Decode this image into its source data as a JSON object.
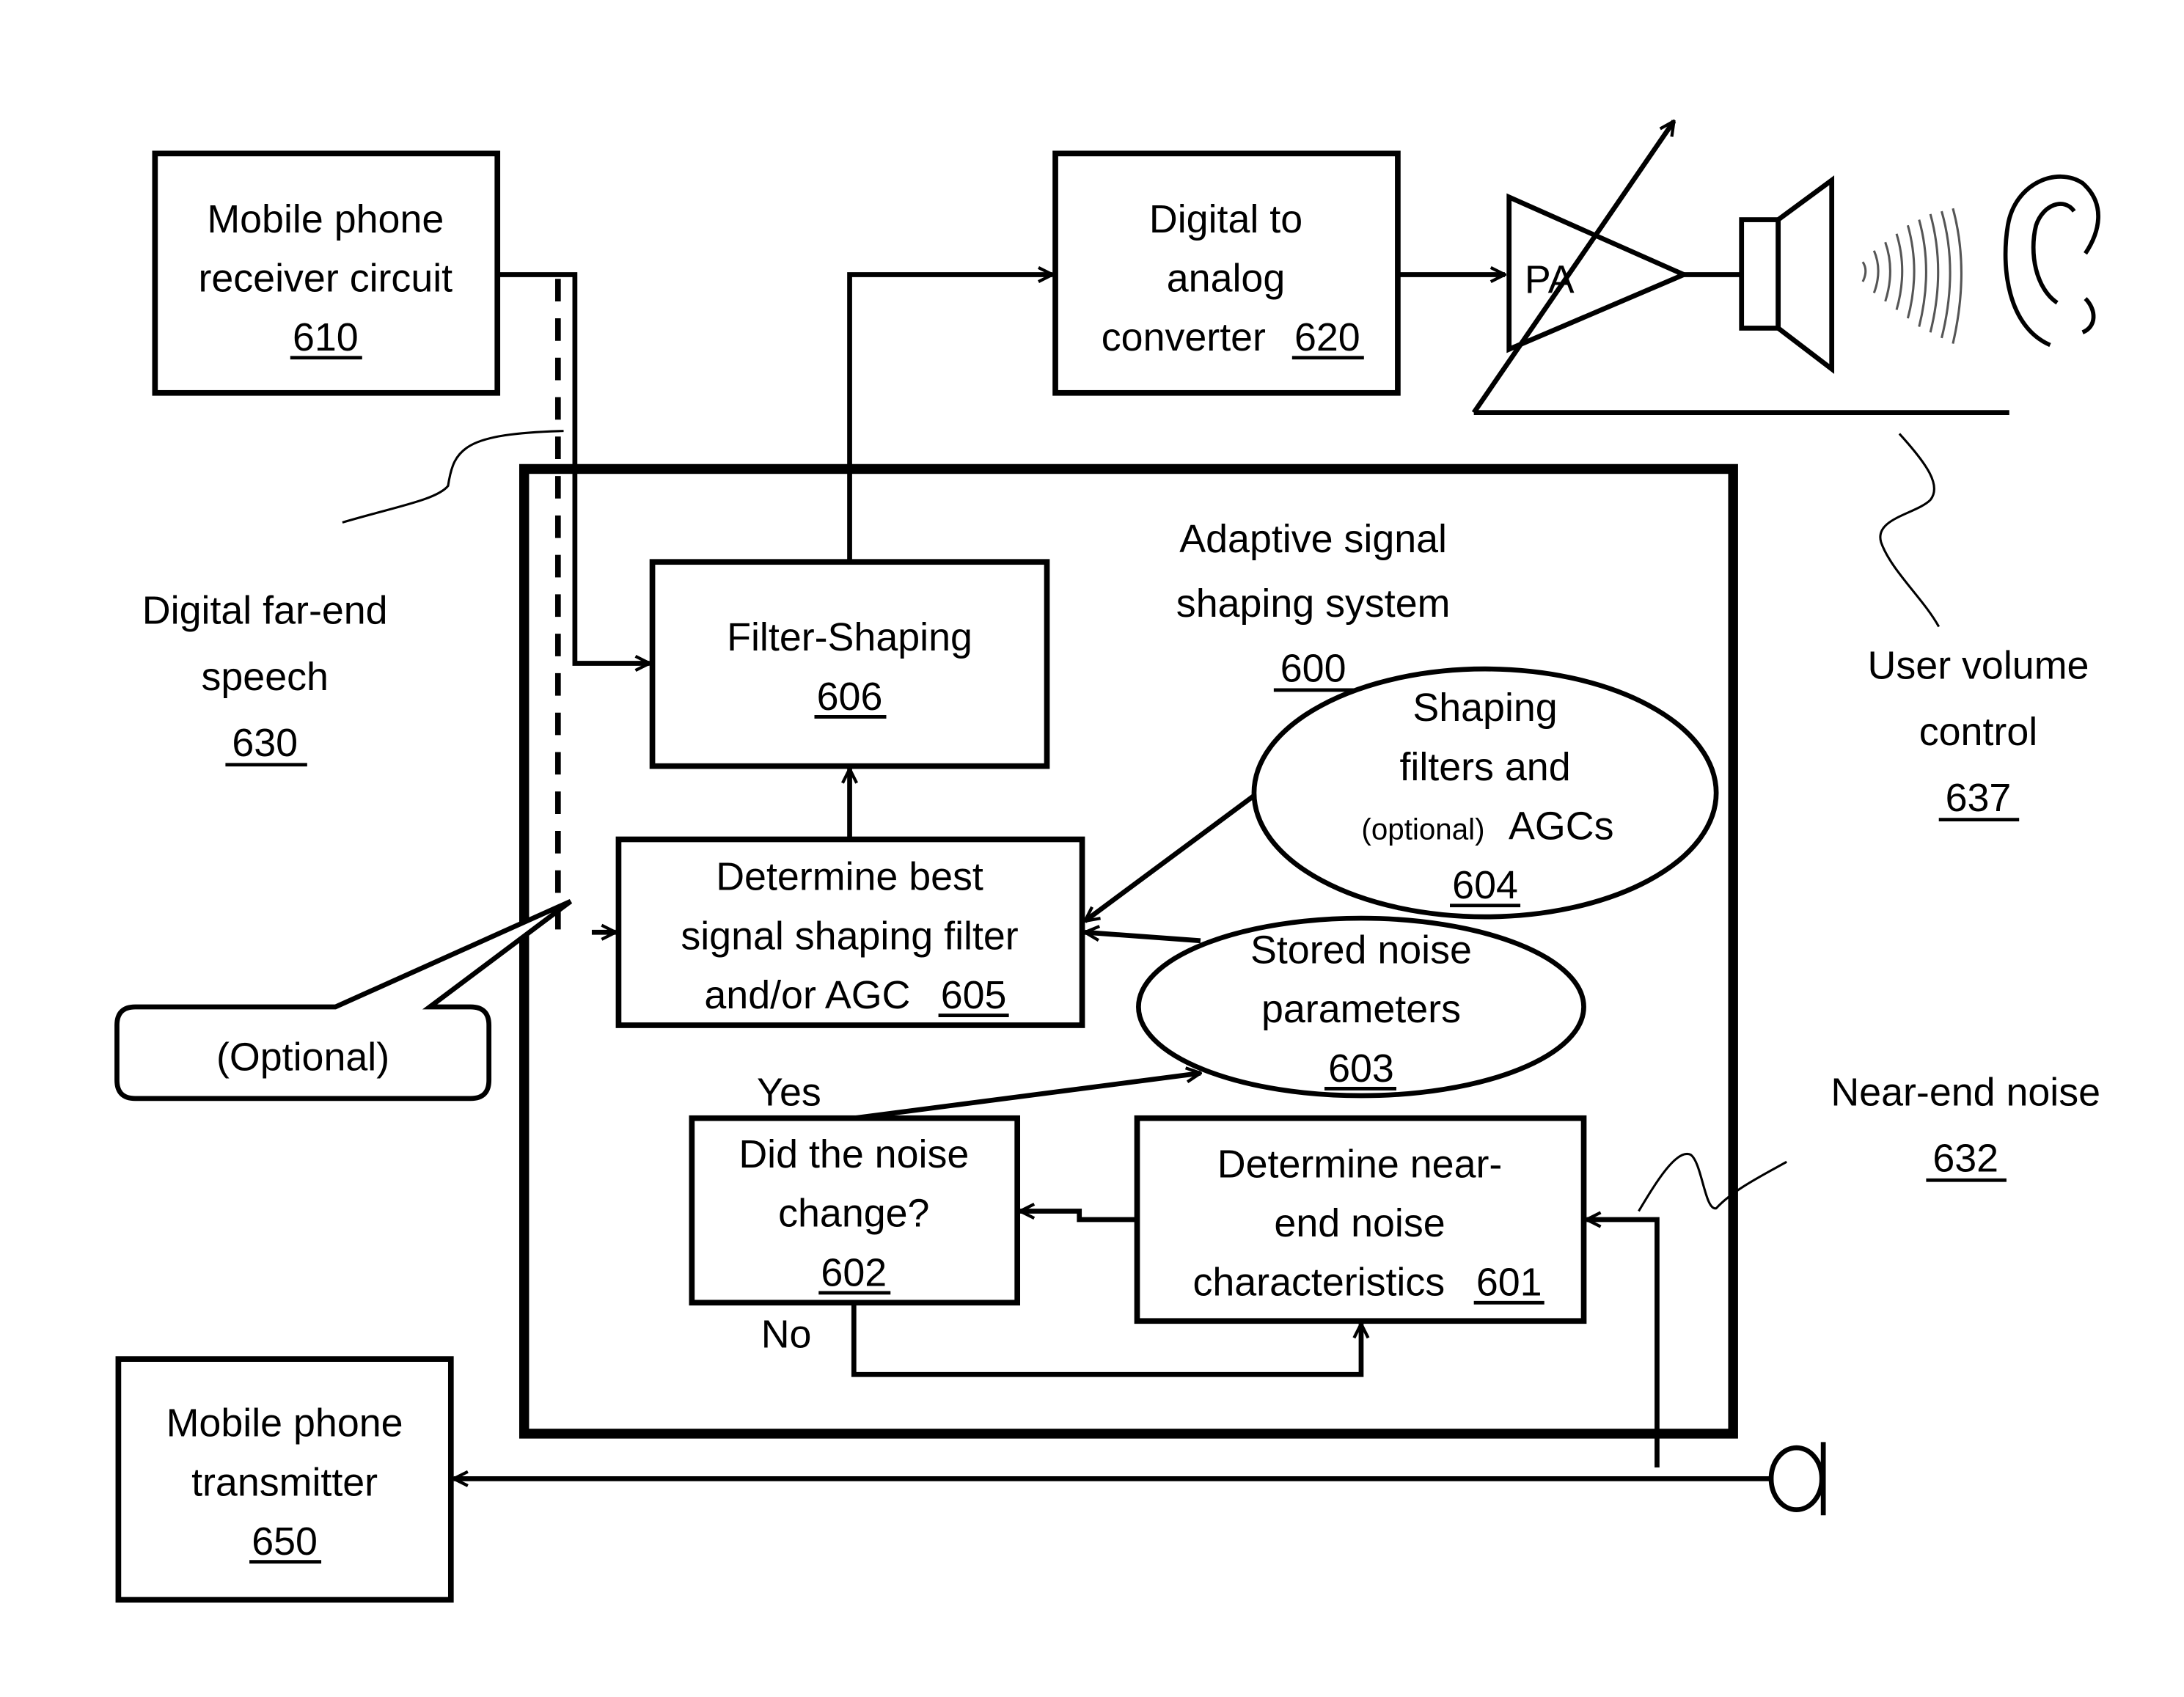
{
  "diagram": {
    "system": {
      "line1": "Adaptive signal",
      "line2": "shaping system",
      "ref": "600"
    },
    "blocks": {
      "receiver": {
        "line1": "Mobile phone",
        "line2": "receiver circuit",
        "ref": "610"
      },
      "dac": {
        "line1": "Digital to",
        "line2": "analog",
        "line3": "converter",
        "ref": "620"
      },
      "filter_shaping": {
        "line1": "Filter-Shaping",
        "ref": "606"
      },
      "determine_best": {
        "line1": "Determine best",
        "line2": "signal shaping filter",
        "line3": "and/or AGC",
        "ref": "605"
      },
      "did_noise_change": {
        "line1": "Did the noise",
        "line2": "change?",
        "ref": "602"
      },
      "determine_near_end": {
        "line1": "Determine near-",
        "line2": "end noise",
        "line3": "characteristics",
        "ref": "601"
      },
      "transmitter": {
        "line1": "Mobile phone",
        "line2": "transmitter",
        "ref": "650"
      }
    },
    "stores": {
      "shaping_filters": {
        "line1": "Shaping",
        "line2": "filters and",
        "line3_small": "(optional)",
        "line3": "AGCs",
        "ref": "604"
      },
      "stored_noise": {
        "line1": "Stored noise",
        "line2": "parameters",
        "ref": "603"
      }
    },
    "amplifier_label": "PA",
    "decision_labels": {
      "yes": "Yes",
      "no": "No"
    },
    "callouts": {
      "far_end_speech": {
        "line1": "Digital far-end",
        "line2": "speech",
        "ref": "630"
      },
      "optional": "(Optional)",
      "user_volume": {
        "line1": "User volume",
        "line2": "control",
        "ref": "637"
      },
      "near_end_noise": {
        "line1": "Near-end noise",
        "ref": "632"
      }
    }
  }
}
